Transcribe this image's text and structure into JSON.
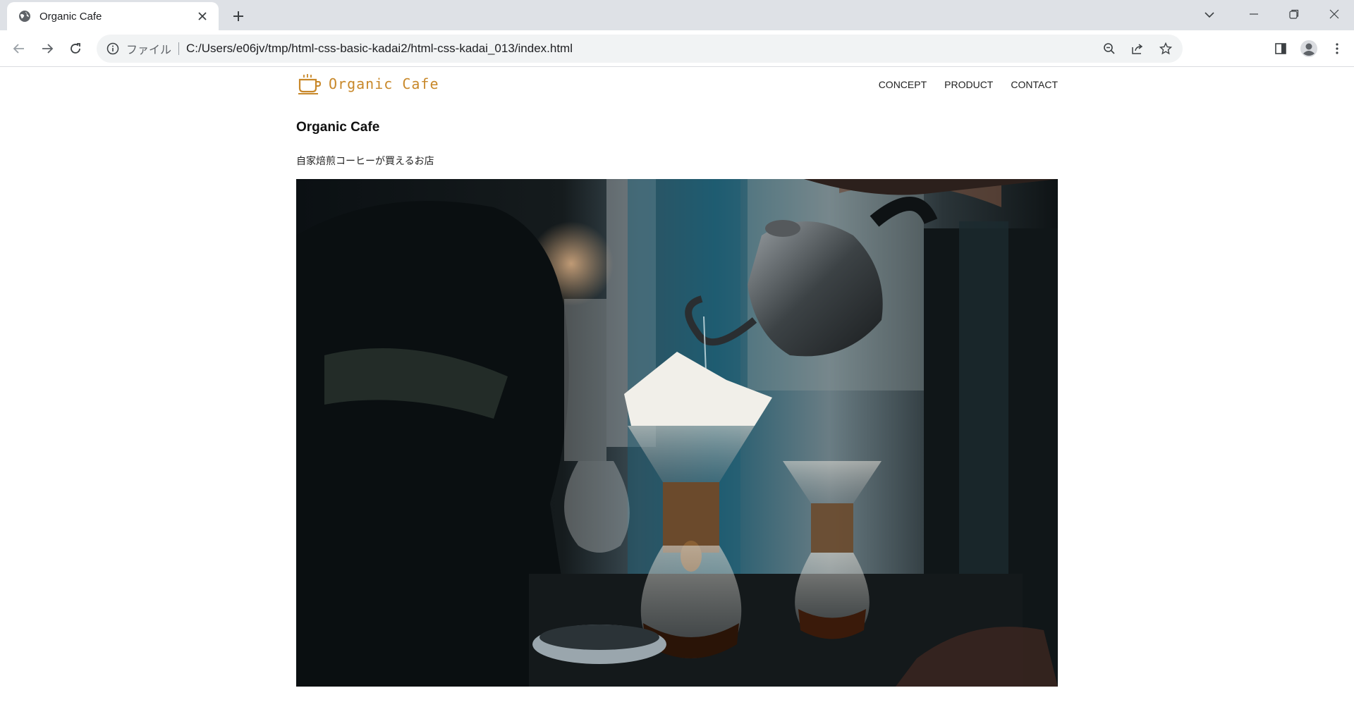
{
  "browser": {
    "tab_title": "Organic Cafe",
    "scheme_label": "ファイル",
    "url": "C:/Users/e06jv/tmp/html-css-basic-kadai2/html-css-kadai_013/index.html",
    "icons": [
      "globe-icon",
      "close-icon",
      "plus-icon",
      "chevron-down-icon",
      "minimize-icon",
      "restore-icon",
      "window-close-icon",
      "back-icon",
      "forward-icon",
      "reload-icon",
      "info-icon",
      "zoom-out-icon",
      "share-icon",
      "star-icon",
      "side-panel-icon",
      "profile-icon",
      "more-icon"
    ]
  },
  "site": {
    "logo_text": "Organic Cafe",
    "nav": [
      "CONCEPT",
      "PRODUCT",
      "CONTACT"
    ],
    "title": "Organic Cafe",
    "catch": "自家焙煎コーヒーが買えるお店",
    "accent": "#c8882a"
  }
}
